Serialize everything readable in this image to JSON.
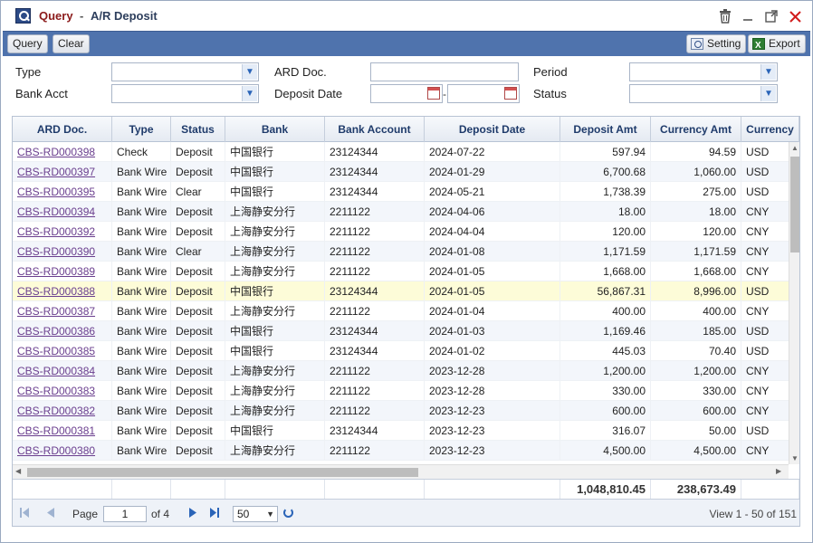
{
  "title": {
    "prefix": "Query",
    "separator": "-",
    "name": "A/R Deposit"
  },
  "toolbar": {
    "query_label": "Query",
    "clear_label": "Clear",
    "setting_label": "Setting",
    "export_label": "Export"
  },
  "filters": {
    "type_label": "Type",
    "bank_acct_label": "Bank Acct",
    "ard_doc_label": "ARD Doc.",
    "deposit_date_label": "Deposit Date",
    "period_label": "Period",
    "status_label": "Status",
    "type_value": "",
    "bank_acct_value": "",
    "ard_doc_value": "",
    "deposit_date_from": "",
    "deposit_date_to": "",
    "period_value": "",
    "status_value": "",
    "date_separator": "-"
  },
  "grid": {
    "columns": [
      "ARD Doc.",
      "Type",
      "Status",
      "Bank",
      "Bank Account",
      "Deposit Date",
      "Deposit Amt",
      "Currency Amt",
      "Currency"
    ],
    "rows": [
      {
        "doc": "CBS-RD000398",
        "type": "Check",
        "status": "Deposit",
        "bank": "中国银行",
        "account": "23124344",
        "date": "2024-07-22",
        "deposit_amt": "597.94",
        "currency_amt": "94.59",
        "currency": "USD"
      },
      {
        "doc": "CBS-RD000397",
        "type": "Bank Wire",
        "status": "Deposit",
        "bank": "中国银行",
        "account": "23124344",
        "date": "2024-01-29",
        "deposit_amt": "6,700.68",
        "currency_amt": "1,060.00",
        "currency": "USD"
      },
      {
        "doc": "CBS-RD000395",
        "type": "Bank Wire",
        "status": "Clear",
        "bank": "中国银行",
        "account": "23124344",
        "date": "2024-05-21",
        "deposit_amt": "1,738.39",
        "currency_amt": "275.00",
        "currency": "USD"
      },
      {
        "doc": "CBS-RD000394",
        "type": "Bank Wire",
        "status": "Deposit",
        "bank": "上海静安分行",
        "account": "2211122",
        "date": "2024-04-06",
        "deposit_amt": "18.00",
        "currency_amt": "18.00",
        "currency": "CNY"
      },
      {
        "doc": "CBS-RD000392",
        "type": "Bank Wire",
        "status": "Deposit",
        "bank": "上海静安分行",
        "account": "2211122",
        "date": "2024-04-04",
        "deposit_amt": "120.00",
        "currency_amt": "120.00",
        "currency": "CNY"
      },
      {
        "doc": "CBS-RD000390",
        "type": "Bank Wire",
        "status": "Clear",
        "bank": "上海静安分行",
        "account": "2211122",
        "date": "2024-01-08",
        "deposit_amt": "1,171.59",
        "currency_amt": "1,171.59",
        "currency": "CNY"
      },
      {
        "doc": "CBS-RD000389",
        "type": "Bank Wire",
        "status": "Deposit",
        "bank": "上海静安分行",
        "account": "2211122",
        "date": "2024-01-05",
        "deposit_amt": "1,668.00",
        "currency_amt": "1,668.00",
        "currency": "CNY"
      },
      {
        "doc": "CBS-RD000388",
        "type": "Bank Wire",
        "status": "Deposit",
        "bank": "中国银行",
        "account": "23124344",
        "date": "2024-01-05",
        "deposit_amt": "56,867.31",
        "currency_amt": "8,996.00",
        "currency": "USD"
      },
      {
        "doc": "CBS-RD000387",
        "type": "Bank Wire",
        "status": "Deposit",
        "bank": "上海静安分行",
        "account": "2211122",
        "date": "2024-01-04",
        "deposit_amt": "400.00",
        "currency_amt": "400.00",
        "currency": "CNY"
      },
      {
        "doc": "CBS-RD000386",
        "type": "Bank Wire",
        "status": "Deposit",
        "bank": "中国银行",
        "account": "23124344",
        "date": "2024-01-03",
        "deposit_amt": "1,169.46",
        "currency_amt": "185.00",
        "currency": "USD"
      },
      {
        "doc": "CBS-RD000385",
        "type": "Bank Wire",
        "status": "Deposit",
        "bank": "中国银行",
        "account": "23124344",
        "date": "2024-01-02",
        "deposit_amt": "445.03",
        "currency_amt": "70.40",
        "currency": "USD"
      },
      {
        "doc": "CBS-RD000384",
        "type": "Bank Wire",
        "status": "Deposit",
        "bank": "上海静安分行",
        "account": "2211122",
        "date": "2023-12-28",
        "deposit_amt": "1,200.00",
        "currency_amt": "1,200.00",
        "currency": "CNY"
      },
      {
        "doc": "CBS-RD000383",
        "type": "Bank Wire",
        "status": "Deposit",
        "bank": "上海静安分行",
        "account": "2211122",
        "date": "2023-12-28",
        "deposit_amt": "330.00",
        "currency_amt": "330.00",
        "currency": "CNY"
      },
      {
        "doc": "CBS-RD000382",
        "type": "Bank Wire",
        "status": "Deposit",
        "bank": "上海静安分行",
        "account": "2211122",
        "date": "2023-12-23",
        "deposit_amt": "600.00",
        "currency_amt": "600.00",
        "currency": "CNY"
      },
      {
        "doc": "CBS-RD000381",
        "type": "Bank Wire",
        "status": "Deposit",
        "bank": "中国银行",
        "account": "23124344",
        "date": "2023-12-23",
        "deposit_amt": "316.07",
        "currency_amt": "50.00",
        "currency": "USD"
      },
      {
        "doc": "CBS-RD000380",
        "type": "Bank Wire",
        "status": "Deposit",
        "bank": "上海静安分行",
        "account": "2211122",
        "date": "2023-12-23",
        "deposit_amt": "4,500.00",
        "currency_amt": "4,500.00",
        "currency": "CNY"
      }
    ],
    "selected_row": 7,
    "totals": {
      "deposit_amt": "1,048,810.45",
      "currency_amt": "238,673.49"
    }
  },
  "pager": {
    "page_label": "Page",
    "page_value": "1",
    "of_label": "of 4",
    "page_size": "50",
    "info": "View 1 - 50 of 151"
  },
  "icons": {
    "app": "search-window-icon",
    "trash": "trash-icon",
    "minimize": "minimize-icon",
    "maximize": "maximize-icon",
    "close": "close-icon",
    "setting": "gear-icon",
    "export": "excel-icon",
    "first": "first-page-icon",
    "prev": "prev-page-icon",
    "next": "next-page-icon",
    "last": "last-page-icon",
    "refresh": "refresh-icon"
  },
  "colors": {
    "toolbar": "#4f73ad",
    "title_prefix": "#8b1a1a",
    "link": "#6a3e8e",
    "selected_row": "#fdfcd8",
    "close": "#d21c1c"
  }
}
